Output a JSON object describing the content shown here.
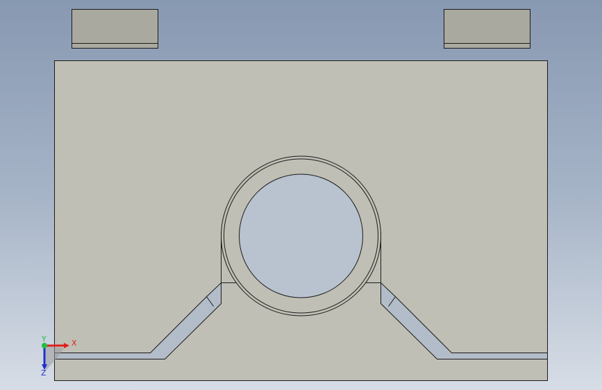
{
  "viewport": {
    "background_top": "#8798b1",
    "background_bottom": "#d7dde6"
  },
  "part": {
    "face_color": "#c0bfb5",
    "tab_color": "#a9a99f",
    "edge_color": "#1a1a1a",
    "hole_color": "#b8c3cf",
    "slot_color": "#b3bcc9"
  },
  "triad": {
    "x_label": "X",
    "y_label": "Y",
    "z_label": "Z",
    "x_color": "#e02020",
    "y_color": "#20c040",
    "z_color": "#2030d0"
  }
}
